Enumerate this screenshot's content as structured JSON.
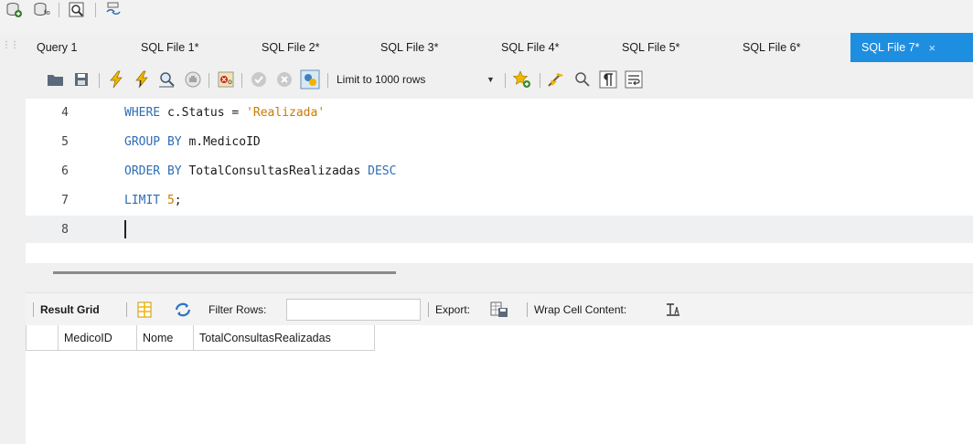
{
  "top_toolbar": {
    "icons": [
      "new-schema-icon",
      "new-table-icon",
      "inspect-icon",
      "reconnect-icon"
    ]
  },
  "tabs": [
    {
      "label": "Query 1",
      "active": false
    },
    {
      "label": "SQL File 1*",
      "active": false
    },
    {
      "label": "SQL File 2*",
      "active": false
    },
    {
      "label": "SQL File 3*",
      "active": false
    },
    {
      "label": "SQL File 4*",
      "active": false
    },
    {
      "label": "SQL File 5*",
      "active": false
    },
    {
      "label": "SQL File 6*",
      "active": false
    },
    {
      "label": "SQL File 7*",
      "active": true
    }
  ],
  "tab_close": "×",
  "editor_toolbar": {
    "limit_label": "Limit to 1000 rows",
    "limit_arrow": "▼"
  },
  "editor": {
    "lines": [
      {
        "num": "4",
        "kw1": "WHERE",
        "rest1": " c.Status = ",
        "str": "'Realizada'"
      },
      {
        "num": "5",
        "kw1": "GROUP BY",
        "rest1": " m.MedicoID"
      },
      {
        "num": "6",
        "kw1": "ORDER BY",
        "rest1": " TotalConsultasRealizadas ",
        "kw2": "DESC"
      },
      {
        "num": "7",
        "kw1": "LIMIT",
        "rest1": " ",
        "numlit": "5",
        "rest2": ";"
      },
      {
        "num": "8"
      }
    ]
  },
  "result_toolbar": {
    "result_grid_label": "Result Grid",
    "filter_label": "Filter Rows:",
    "filter_value": "",
    "export_label": "Export:",
    "wrap_label": "Wrap Cell Content:"
  },
  "grid": {
    "columns": [
      "MedicoID",
      "Nome",
      "TotalConsultasRealizadas"
    ]
  },
  "colors": {
    "active_tab": "#1e8ee0",
    "keyword": "#2e6db4",
    "string": "#cc7a00"
  }
}
